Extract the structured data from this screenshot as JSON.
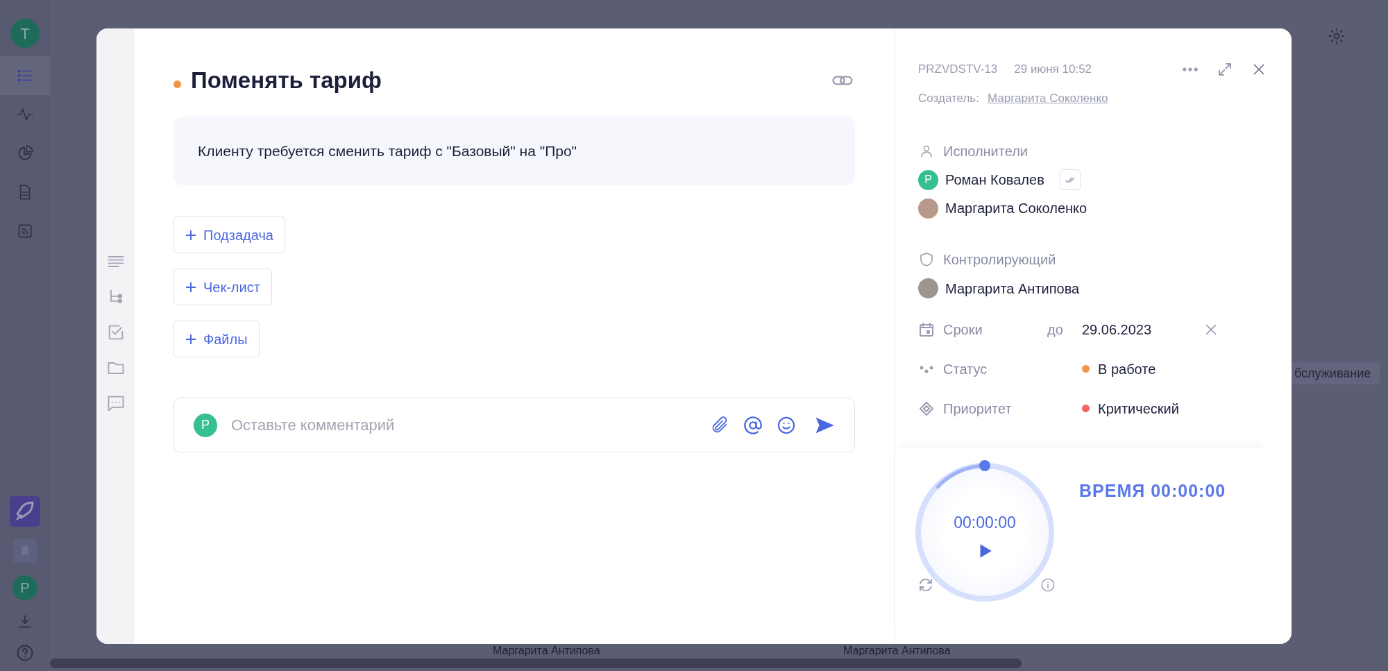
{
  "app_sidebar": {
    "avatar": "T",
    "items": [
      {
        "selected": true
      },
      {
        "selected": false
      },
      {
        "selected": false
      },
      {
        "selected": false
      },
      {
        "selected": false
      }
    ],
    "bottom_avatar": "P"
  },
  "background": {
    "tag": "бслуживание",
    "names": [
      "Маргарита Антипова",
      "Маргарита Антипова"
    ]
  },
  "task": {
    "title": "Поменять тариф",
    "description": "Клиенту требуется сменить тариф с \"Базовый\" на \"Про\"",
    "add_buttons": [
      "Подзадача",
      "Чек-лист",
      "Файлы"
    ],
    "comment": {
      "avatar": "Р",
      "placeholder": "Оставьте комментарий"
    }
  },
  "details": {
    "id": "PRZVDSTV-13",
    "date": "29 июня 10:52",
    "creator_label": "Создатель:",
    "creator": "Маргарита Соколенко",
    "assignees_label": "Исполнители",
    "assignees": [
      {
        "name": "Роман Ковалев",
        "avatar": "Р",
        "kind": "letter",
        "confirmed": false
      },
      {
        "name": "Маргарита Соколенко",
        "kind": "photo"
      }
    ],
    "controller_label": "Контролирующий",
    "controller": "Маргарита Антипова",
    "fields": [
      {
        "kind": "deadline",
        "label": "Сроки",
        "prefix": "до",
        "value": "29.06.2023"
      },
      {
        "kind": "status",
        "label": "Статус",
        "value": "В работе",
        "color": "#f0954a"
      },
      {
        "kind": "priority",
        "label": "Приоритет",
        "value": "Критический",
        "color": "#f56565"
      }
    ]
  },
  "timer": {
    "time": "00:00:00",
    "total": "ВРЕМЯ 00:00:00"
  }
}
